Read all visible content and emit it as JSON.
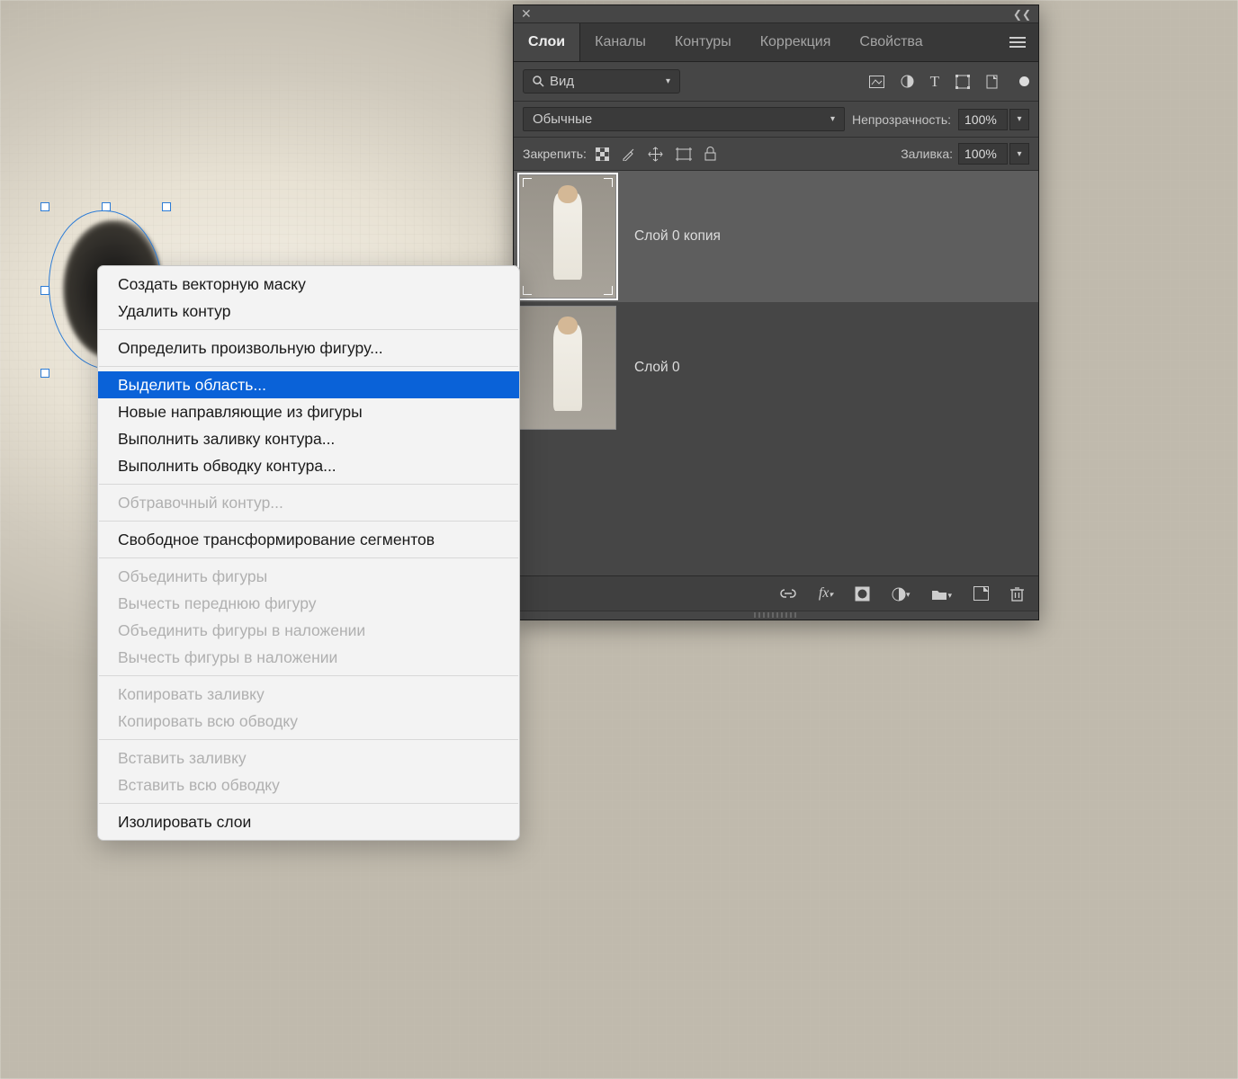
{
  "panel": {
    "tabs": [
      "Слои",
      "Каналы",
      "Контуры",
      "Коррекция",
      "Свойства"
    ],
    "activeTab": 0,
    "search": {
      "placeholder": "Вид"
    },
    "blend": {
      "mode": "Обычные",
      "opacityLabel": "Непрозрачность:",
      "opacityValue": "100%"
    },
    "lock": {
      "label": "Закрепить:",
      "fillLabel": "Заливка:",
      "fillValue": "100%"
    },
    "layers": [
      {
        "name": "Слой 0 копия",
        "selected": true
      },
      {
        "name": "Слой 0",
        "selected": false
      }
    ]
  },
  "contextMenu": {
    "items": [
      {
        "label": "Создать векторную маску",
        "enabled": true
      },
      {
        "label": "Удалить контур",
        "enabled": true
      },
      {
        "divider": true
      },
      {
        "label": "Определить произвольную фигуру...",
        "enabled": true
      },
      {
        "divider": true
      },
      {
        "label": "Выделить область...",
        "enabled": true,
        "selected": true
      },
      {
        "label": "Новые направляющие из фигуры",
        "enabled": true
      },
      {
        "label": "Выполнить заливку контура...",
        "enabled": true
      },
      {
        "label": "Выполнить обводку контура...",
        "enabled": true
      },
      {
        "divider": true
      },
      {
        "label": "Обтравочный контур...",
        "enabled": false
      },
      {
        "divider": true
      },
      {
        "label": "Свободное трансформирование сегментов",
        "enabled": true
      },
      {
        "divider": true
      },
      {
        "label": "Объединить фигуры",
        "enabled": false
      },
      {
        "label": "Вычесть переднюю фигуру",
        "enabled": false
      },
      {
        "label": "Объединить фигуры в наложении",
        "enabled": false
      },
      {
        "label": "Вычесть фигуры в наложении",
        "enabled": false
      },
      {
        "divider": true
      },
      {
        "label": "Копировать заливку",
        "enabled": false
      },
      {
        "label": "Копировать всю обводку",
        "enabled": false
      },
      {
        "divider": true
      },
      {
        "label": "Вставить заливку",
        "enabled": false
      },
      {
        "label": "Вставить всю обводку",
        "enabled": false
      },
      {
        "divider": true
      },
      {
        "label": "Изолировать слои",
        "enabled": true
      }
    ]
  }
}
